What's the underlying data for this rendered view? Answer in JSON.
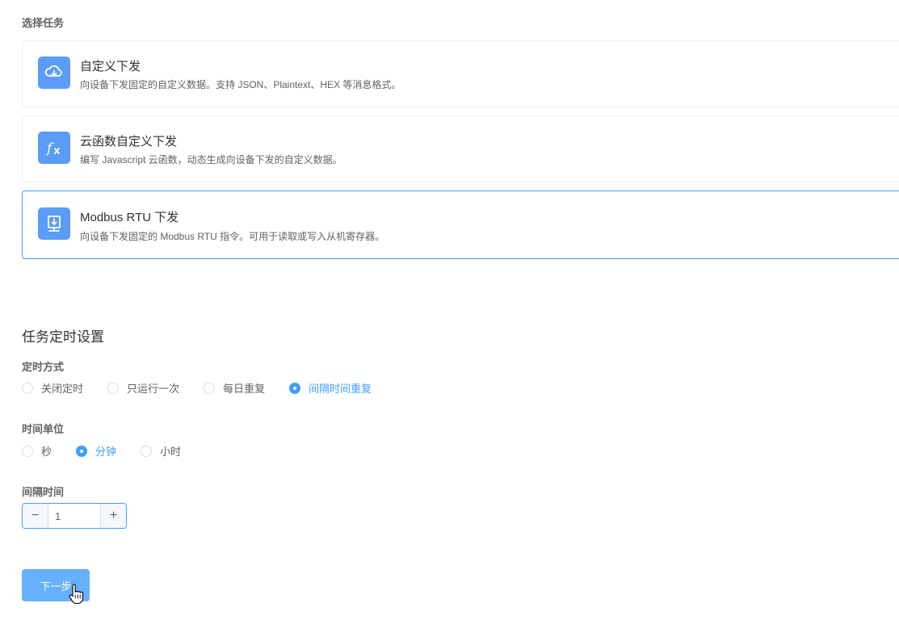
{
  "select_task": {
    "label": "选择任务",
    "tasks": [
      {
        "icon": "cloud-download-icon",
        "title": "自定义下发",
        "desc": "向设备下发固定的自定义数据。支持 JSON、Plaintext、HEX 等消息格式。",
        "selected": false
      },
      {
        "icon": "function-fx-icon",
        "title": "云函数自定义下发",
        "desc": "编写 Javascript 云函数，动态生成向设备下发的自定义数据。",
        "selected": false
      },
      {
        "icon": "device-download-icon",
        "title": "Modbus RTU 下发",
        "desc": "向设备下发固定的 Modbus RTU 指令。可用于读取或写入从机寄存器。",
        "selected": true
      }
    ]
  },
  "schedule": {
    "heading": "任务定时设置",
    "mode": {
      "label": "定时方式",
      "options": [
        "关闭定时",
        "只运行一次",
        "每日重复",
        "间隔时间重复"
      ],
      "selected": "间隔时间重复"
    },
    "unit": {
      "label": "时间单位",
      "options": [
        "秒",
        "分钟",
        "小时"
      ],
      "selected": "分钟"
    },
    "interval": {
      "label": "间隔时间",
      "value": "1",
      "decrement": "−",
      "increment": "+"
    }
  },
  "next_button": "下一步",
  "colors": {
    "primary": "#409eff",
    "icon_bg": "#5a9cf8",
    "button_bg": "#66b1ff"
  }
}
